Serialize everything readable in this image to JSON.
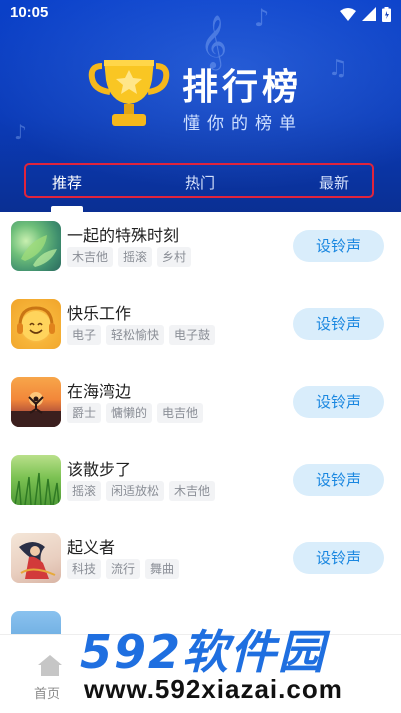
{
  "status_bar": {
    "time": "10:05",
    "icons": [
      "wifi-icon",
      "signal-icon",
      "battery-icon"
    ]
  },
  "header": {
    "title": "排行榜",
    "subtitle": "懂你的榜单"
  },
  "tabs": [
    {
      "label": "推荐",
      "active": true
    },
    {
      "label": "热门",
      "active": false
    },
    {
      "label": "最新",
      "active": false
    }
  ],
  "songs": [
    {
      "name": "一起的特殊时刻",
      "tags": [
        "木吉他",
        "摇滚",
        "乡村"
      ],
      "button": "设铃声",
      "thumb": "green-leaves"
    },
    {
      "name": "快乐工作",
      "tags": [
        "电子",
        "轻松愉快",
        "电子鼓"
      ],
      "button": "设铃声",
      "thumb": "smiley-headphones"
    },
    {
      "name": "在海湾边",
      "tags": [
        "爵士",
        "慵懒的",
        "电吉他"
      ],
      "button": "设铃声",
      "thumb": "sunset-yoga"
    },
    {
      "name": "该散步了",
      "tags": [
        "摇滚",
        "闲适放松",
        "木吉他"
      ],
      "button": "设铃声",
      "thumb": "green-grass"
    },
    {
      "name": "起义者",
      "tags": [
        "科技",
        "流行",
        "舞曲"
      ],
      "button": "设铃声",
      "thumb": "dancer-illustration"
    }
  ],
  "bottom_nav": {
    "home_label": "首页"
  },
  "watermark": {
    "logo": "592软件园",
    "url": "www.592xiazai.com"
  },
  "colors": {
    "header_blue": "#0b3bb8",
    "tab_highlight_border": "#e0243c",
    "button_bg": "#d9edfb",
    "button_text": "#1a87e0",
    "trophy_gold": "#f5b81c"
  }
}
